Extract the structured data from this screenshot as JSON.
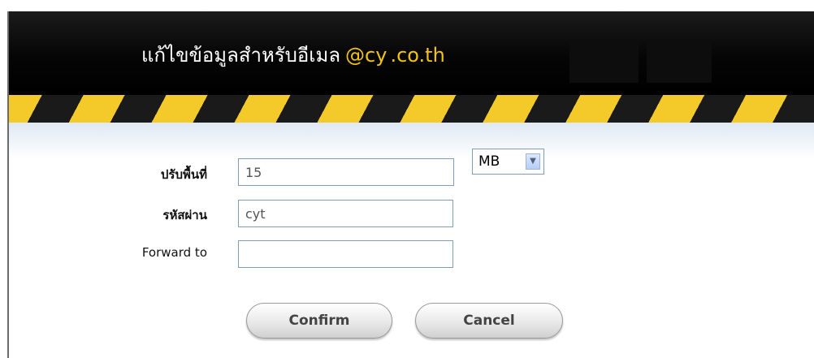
{
  "dialog": {
    "title_thai": "แก้ไขข้อมูลสำหรับอีเมล",
    "title_domain": "@cy",
    "title_suffix": ".co.th"
  },
  "form": {
    "quota": {
      "label": "ปรับพื้นที่",
      "value": "15"
    },
    "unit": {
      "selected": "MB"
    },
    "password": {
      "label": "รหัสผ่าน",
      "value": "cyt"
    },
    "forward": {
      "label": "Forward to",
      "value": ""
    }
  },
  "buttons": {
    "confirm": "Confirm",
    "cancel": "Cancel"
  },
  "colors": {
    "accent": "#f1c40f",
    "header_bg": "#000000",
    "hazard_yellow": "#f4c92a",
    "hazard_black": "#1a1a1a"
  },
  "icons": {
    "select_arrow": "chevron-down-icon"
  }
}
